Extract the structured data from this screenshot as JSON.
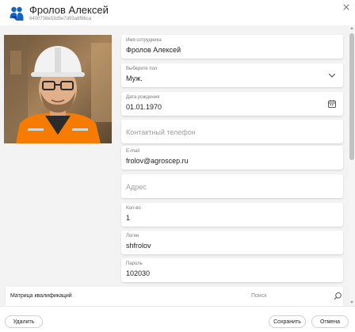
{
  "header": {
    "title": "Фролов Алексей",
    "subtitle": "6400736e53d5e7d93a8f86ca"
  },
  "colors": {
    "accent": "#1565c0",
    "background": "#f3f3f3"
  },
  "icons": {
    "logo": "people-logo-icon",
    "close": "close-icon",
    "gender_dropdown": "chevron-down-icon",
    "birth_date": "calendar-icon",
    "matrix_search": "search-icon"
  },
  "form": {
    "name": {
      "label": "Имя сотрудника",
      "value": "Фролов Алексей"
    },
    "gender": {
      "label": "Выберите пол",
      "value": "Муж."
    },
    "birth_date": {
      "label": "Дата рождения",
      "value": "01.01.1970"
    },
    "phone": {
      "placeholder": "Контактный телефон"
    },
    "email": {
      "label": "E-mail",
      "value": "frolov@agroscep.ru"
    },
    "address": {
      "placeholder": "Адрес"
    },
    "quantity": {
      "label": "Кол-во",
      "value": "1"
    },
    "login": {
      "label": "Логин",
      "value": "shfrolov"
    },
    "password": {
      "label": "Пароль",
      "value": "102030"
    }
  },
  "matrix": {
    "title": "Матрица квалификаций",
    "search_placeholder": "Поиск"
  },
  "footer": {
    "delete_label": "Удалить",
    "save_label": "Сохранить",
    "cancel_label": "Отмена"
  }
}
